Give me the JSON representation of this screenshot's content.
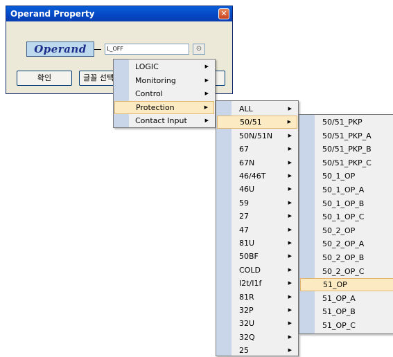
{
  "dialog": {
    "title": "Operand Property",
    "close_glyph": "✕",
    "operand_label": "Operand",
    "operand_value": "L_OFF",
    "dropdown_glyph": "⊙",
    "ok_button": "확인",
    "font_button": "글꼴 선택",
    "third_button": ""
  },
  "menu1": {
    "items": [
      {
        "label": "LOGIC"
      },
      {
        "label": "Monitoring"
      },
      {
        "label": "Control"
      },
      {
        "label": "Protection",
        "selected": true
      },
      {
        "label": "Contact Input"
      }
    ]
  },
  "menu2": {
    "items": [
      {
        "label": "ALL"
      },
      {
        "label": "50/51",
        "selected": true
      },
      {
        "label": "50N/51N"
      },
      {
        "label": "67"
      },
      {
        "label": "67N"
      },
      {
        "label": "46/46T"
      },
      {
        "label": "46U"
      },
      {
        "label": "59"
      },
      {
        "label": "27"
      },
      {
        "label": "47"
      },
      {
        "label": "81U"
      },
      {
        "label": "50BF"
      },
      {
        "label": "COLD"
      },
      {
        "label": "I2t/I1f"
      },
      {
        "label": "81R"
      },
      {
        "label": "32P"
      },
      {
        "label": "32U"
      },
      {
        "label": "32Q"
      },
      {
        "label": "25"
      }
    ]
  },
  "menu3": {
    "items": [
      {
        "label": "50/51_PKP"
      },
      {
        "label": "50/51_PKP_A"
      },
      {
        "label": "50/51_PKP_B"
      },
      {
        "label": "50/51_PKP_C"
      },
      {
        "label": "50_1_OP"
      },
      {
        "label": "50_1_OP_A"
      },
      {
        "label": "50_1_OP_B"
      },
      {
        "label": "50_1_OP_C"
      },
      {
        "label": "50_2_OP"
      },
      {
        "label": "50_2_OP_A"
      },
      {
        "label": "50_2_OP_B"
      },
      {
        "label": "50_2_OP_C"
      },
      {
        "label": "51_OP",
        "selected": true
      },
      {
        "label": "51_OP_A"
      },
      {
        "label": "51_OP_B"
      },
      {
        "label": "51_OP_C"
      }
    ]
  },
  "submenu_arrow_glyph": "▶"
}
